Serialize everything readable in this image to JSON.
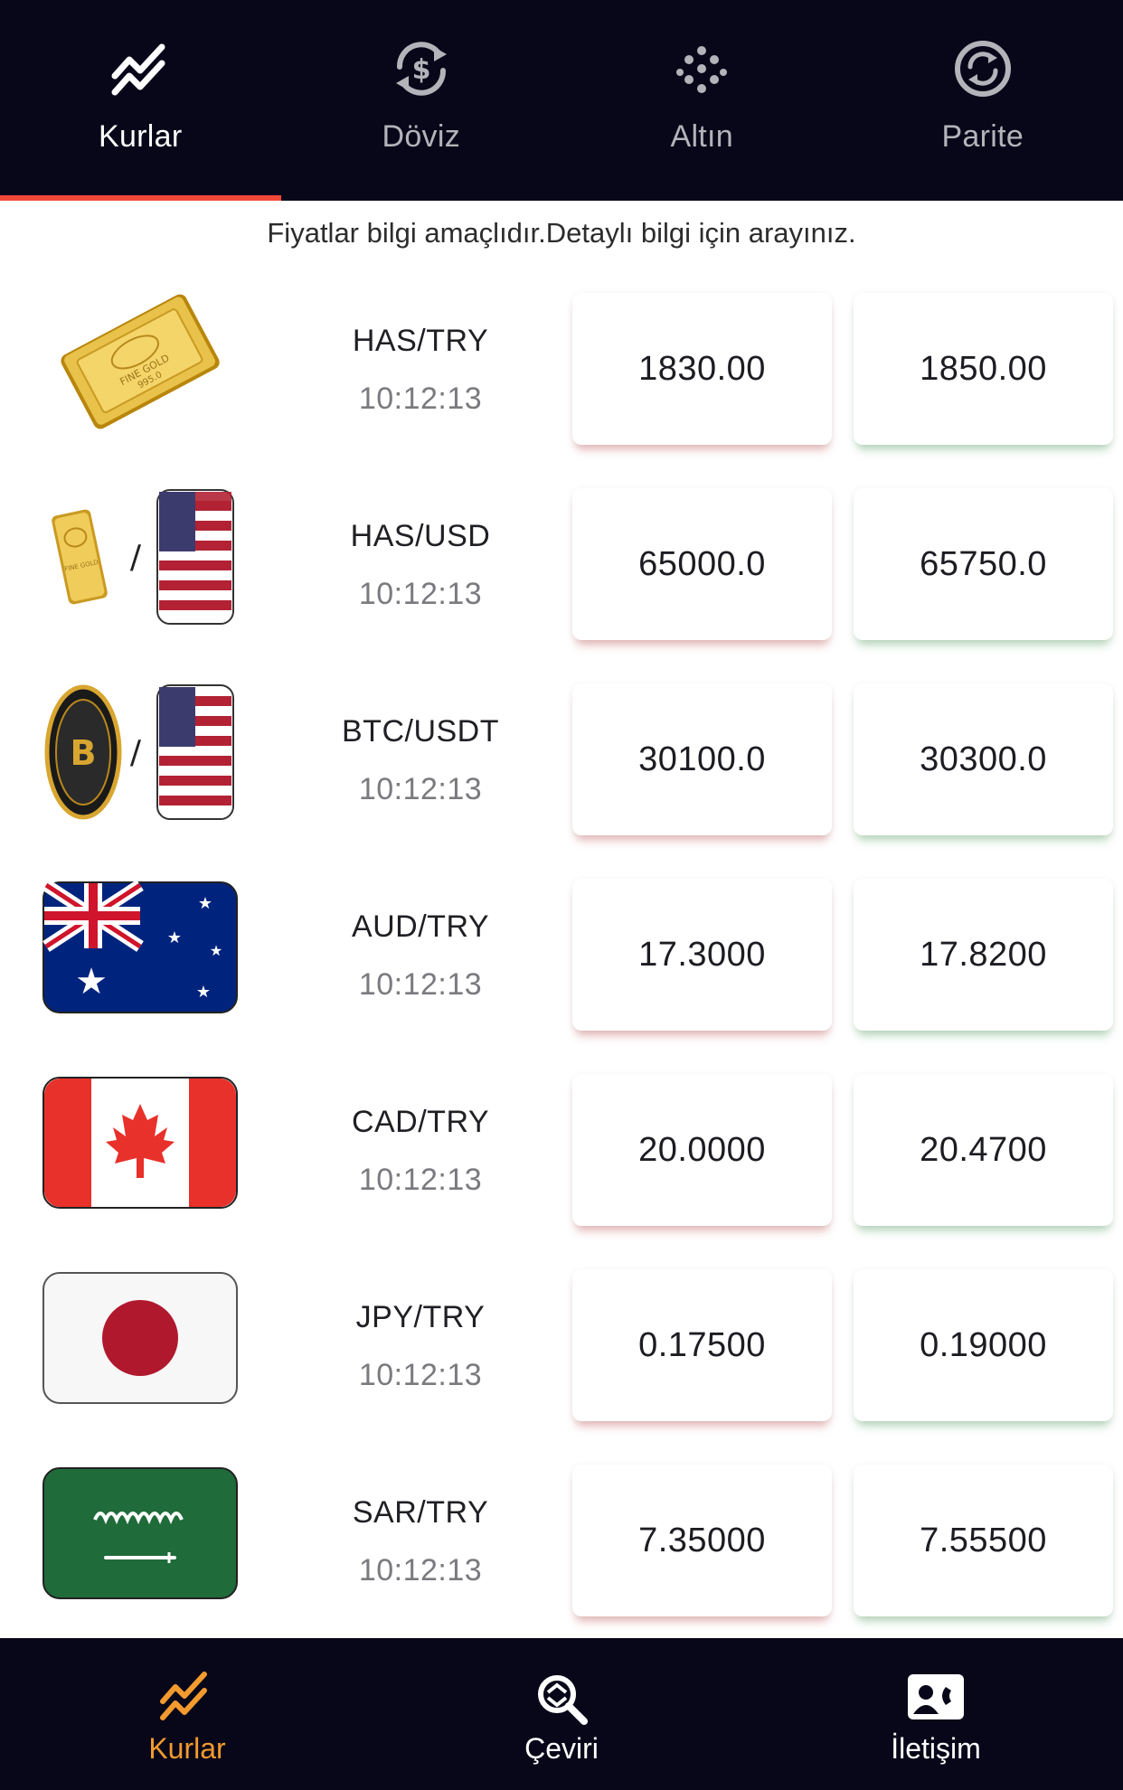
{
  "top_tabs": [
    {
      "label": "Kurlar",
      "icon": "trend-icon",
      "active": true
    },
    {
      "label": "Döviz",
      "icon": "currency-exchange-icon",
      "active": false
    },
    {
      "label": "Altın",
      "icon": "dots-grid-icon",
      "active": false
    },
    {
      "label": "Parite",
      "icon": "parity-icon",
      "active": false
    }
  ],
  "notice": "Fiyatlar bilgi amaçlıdır.Detaylı bilgi için arayınız.",
  "rows": [
    {
      "pair": "HAS/TRY",
      "time": "10:12:13",
      "buy": "1830.00",
      "sell": "1850.00",
      "icon": "gold-bar-icon"
    },
    {
      "pair": "HAS/USD",
      "time": "10:12:13",
      "buy": "65000.0",
      "sell": "65750.0",
      "icon": "gold-usd-icon"
    },
    {
      "pair": "BTC/USDT",
      "time": "10:12:13",
      "buy": "30100.0",
      "sell": "30300.0",
      "icon": "bitcoin-usd-icon"
    },
    {
      "pair": "AUD/TRY",
      "time": "10:12:13",
      "buy": "17.3000",
      "sell": "17.8200",
      "icon": "australia-flag-icon"
    },
    {
      "pair": "CAD/TRY",
      "time": "10:12:13",
      "buy": "20.0000",
      "sell": "20.4700",
      "icon": "canada-flag-icon"
    },
    {
      "pair": "JPY/TRY",
      "time": "10:12:13",
      "buy": "0.17500",
      "sell": "0.19000",
      "icon": "japan-flag-icon"
    },
    {
      "pair": "SAR/TRY",
      "time": "10:12:13",
      "buy": "7.35000",
      "sell": "7.55500",
      "icon": "saudi-flag-icon"
    }
  ],
  "separator": "/",
  "bottom_nav": [
    {
      "label": "Kurlar",
      "icon": "trend-icon",
      "active": true
    },
    {
      "label": "Çeviri",
      "icon": "convert-search-icon",
      "active": false
    },
    {
      "label": "İletişim",
      "icon": "contact-card-icon",
      "active": false
    }
  ],
  "colors": {
    "bar_background": "#080719",
    "active_underline": "#f2483a",
    "active_bottom_label": "#f39a2f",
    "buy_shadow": "#d67a7a",
    "sell_shadow": "#7aba84"
  }
}
